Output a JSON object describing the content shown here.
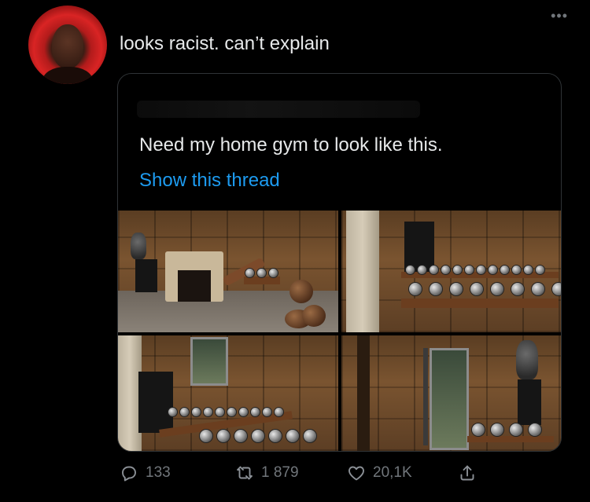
{
  "tweet": {
    "text": "looks racist. can’t explain",
    "more_label": "•••"
  },
  "quote": {
    "text": "Need my home gym to look like this.",
    "show_thread": "Show this thread"
  },
  "actions": {
    "reply_count": "133",
    "retweet_count": "1 879",
    "like_count": "20,1K"
  },
  "icons": {
    "reply": "reply-icon",
    "retweet": "retweet-icon",
    "like": "heart-icon",
    "share": "share-icon",
    "more": "more-icon"
  },
  "colors": {
    "background": "#000000",
    "text": "#e7e9ea",
    "link": "#1d9bf0",
    "muted": "#71767b",
    "border": "#2f3336"
  }
}
